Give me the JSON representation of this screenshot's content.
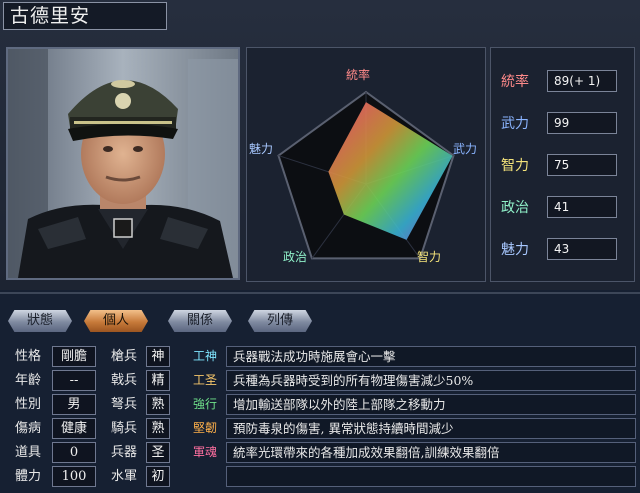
{
  "character": {
    "name": "古德里安"
  },
  "radar": {
    "axes": [
      "統率",
      "武力",
      "智力",
      "政治",
      "魅力"
    ],
    "values": [
      89,
      99,
      75,
      41,
      43
    ],
    "max": 100,
    "label_colors": [
      "#ff8a8a",
      "#8ab4ff",
      "#f4e37a",
      "#8ff0c8",
      "#a8c8ff"
    ]
  },
  "stats": [
    {
      "label": "統率",
      "value": "89(+ 1)",
      "color": "#ff8a8a"
    },
    {
      "label": "武力",
      "value": "99",
      "color": "#8ab4ff"
    },
    {
      "label": "智力",
      "value": "75",
      "color": "#f4e37a"
    },
    {
      "label": "政治",
      "value": "41",
      "color": "#8ff0c8"
    },
    {
      "label": "魅力",
      "value": "43",
      "color": "#a8c8ff"
    }
  ],
  "tabs": [
    "狀態",
    "個人",
    "關係",
    "列傳"
  ],
  "active_tab": "個人",
  "personal": [
    {
      "label": "性格",
      "value": "剛膽"
    },
    {
      "label": "年齡",
      "value": "--"
    },
    {
      "label": "性別",
      "value": "男"
    },
    {
      "label": "傷病",
      "value": "健康"
    },
    {
      "label": "道具",
      "value": "0"
    },
    {
      "label": "體力",
      "value": "100"
    }
  ],
  "aptitudes": [
    {
      "label": "槍兵",
      "value": "神"
    },
    {
      "label": "戟兵",
      "value": "精"
    },
    {
      "label": "弩兵",
      "value": "熟"
    },
    {
      "label": "騎兵",
      "value": "熟"
    },
    {
      "label": "兵器",
      "value": "圣"
    },
    {
      "label": "水軍",
      "value": "初"
    }
  ],
  "skills": [
    {
      "tag": "工神",
      "color": "#7fe6ff",
      "desc": "兵器戰法成功時施展會心一擊"
    },
    {
      "tag": "工圣",
      "color": "#f6c66a",
      "desc": "兵種為兵器時受到的所有物理傷害減少50%"
    },
    {
      "tag": "強行",
      "color": "#6fe08a",
      "desc": "增加輸送部隊以外的陸上部隊之移動力"
    },
    {
      "tag": "堅韌",
      "color": "#ffb04a",
      "desc": "預防毒泉的傷害, 異常狀態持續時間減少"
    },
    {
      "tag": "軍魂",
      "color": "#ff6fa0",
      "desc": "統率光環帶來的各種加成效果翻倍,訓練效果翻倍"
    },
    {
      "tag": "",
      "color": "#888888",
      "desc": ""
    }
  ]
}
